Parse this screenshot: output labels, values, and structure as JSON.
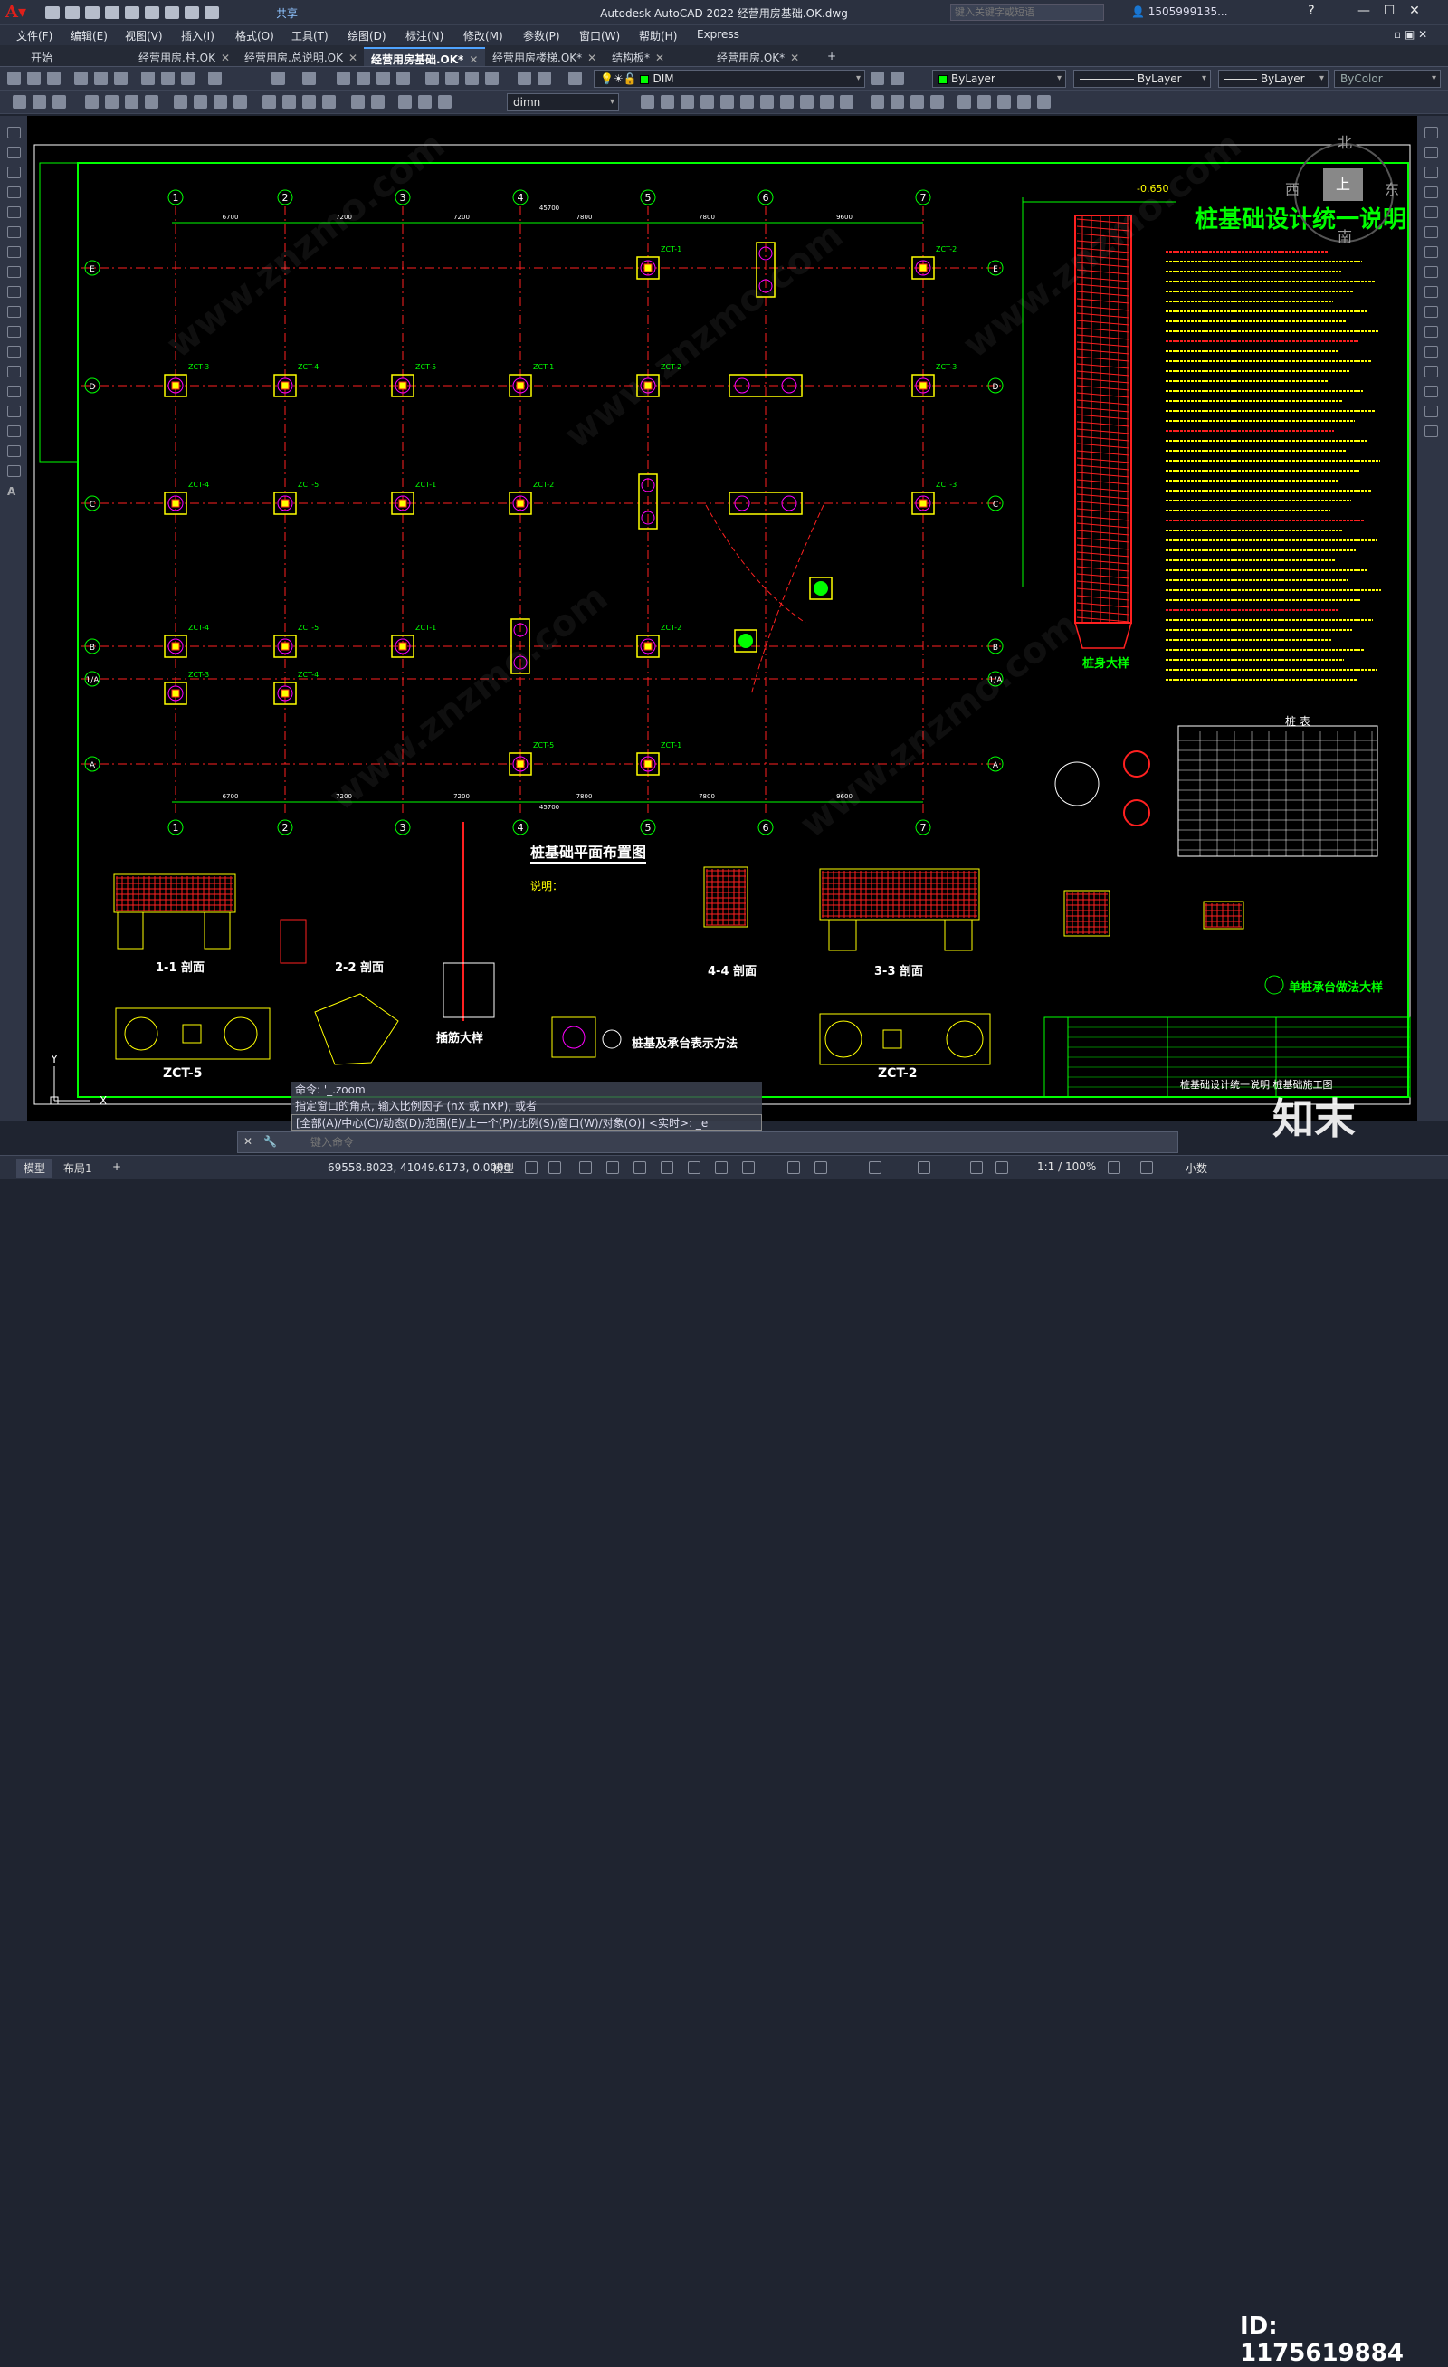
{
  "window": {
    "title": "Autodesk AutoCAD 2022    经营用房基础.OK.dwg",
    "share": "共享",
    "search_placeholder": "键入关键字或短语",
    "user": "1505999135...",
    "help": "?"
  },
  "menu": [
    "文件(F)",
    "编辑(E)",
    "视图(V)",
    "插入(I)",
    "格式(O)",
    "工具(T)",
    "绘图(D)",
    "标注(N)",
    "修改(M)",
    "参数(P)",
    "窗口(W)",
    "帮助(H)",
    "Express"
  ],
  "tabs": [
    {
      "label": "开始"
    },
    {
      "label": "经营用房.柱.OK"
    },
    {
      "label": "经营用房.总说明.OK"
    },
    {
      "label": "经营用房基础.OK*",
      "active": true
    },
    {
      "label": "经营用房楼梯.OK*"
    },
    {
      "label": "结构板*"
    },
    {
      "label": "经营用房.OK*"
    }
  ],
  "toolbar": {
    "layer": "DIM",
    "color": "ByLayer",
    "linetype": "ByLayer",
    "lineweight": "ByLayer",
    "plotstyle": "ByColor",
    "dimstyle": "dimn"
  },
  "colors": {
    "layer_swatch": "#00ff00",
    "accent": "#4fa3ff"
  },
  "viewcube": {
    "north": "北",
    "west": "西",
    "east": "东",
    "south": "南",
    "top": "上"
  },
  "drawing": {
    "plan_title": "桩基础平面布置图",
    "notes_title": "桩基础设计统一说明",
    "pile_detail": "桩身大样",
    "pile_table_title": "桩  表",
    "axis_cols": [
      "1",
      "2",
      "3",
      "4",
      "5",
      "6",
      "7"
    ],
    "axis_rows": [
      "E",
      "D",
      "C",
      "B",
      "1/A",
      "A"
    ],
    "dims_top": [
      "6700",
      "7200",
      "7200",
      "7800",
      "7800",
      "9600"
    ],
    "dim_total": "45700",
    "section_labels": [
      "1-1 剖面",
      "2-2 剖面",
      "插筋大样",
      "桩基及承台表示方法",
      "4-4 剖面",
      "3-3 剖面",
      "单桩承台做法大样"
    ],
    "cap_labels": [
      "ZCT-5",
      "ZCT-2"
    ],
    "grade_note": "-0.650",
    "pile_labels": [
      "ZCT-1",
      "ZCT-2",
      "ZCT-3",
      "ZCT-4",
      "ZCT-5"
    ],
    "legend_note": "说明：",
    "footer_stamp": "桩基础设计统一说明 桩基础施工图"
  },
  "command": {
    "history": [
      "命令: '_.zoom",
      "指定窗口的角点, 输入比例因子 (nX 或 nXP), 或者",
      "[全部(A)/中心(C)/动态(D)/范围(E)/上一个(P)/比例(S)/窗口(W)/对象(O)] <实时>: _e"
    ],
    "placeholder": "键入命令"
  },
  "status": {
    "tabs": [
      "模型",
      "布局1"
    ],
    "coords": "69558.8023, 41049.6173, 0.0000",
    "mode": "模型",
    "scale": "1:1 / 100%",
    "units": "小数"
  },
  "watermark": {
    "brand": "知末",
    "id": "ID: 1175619884"
  }
}
